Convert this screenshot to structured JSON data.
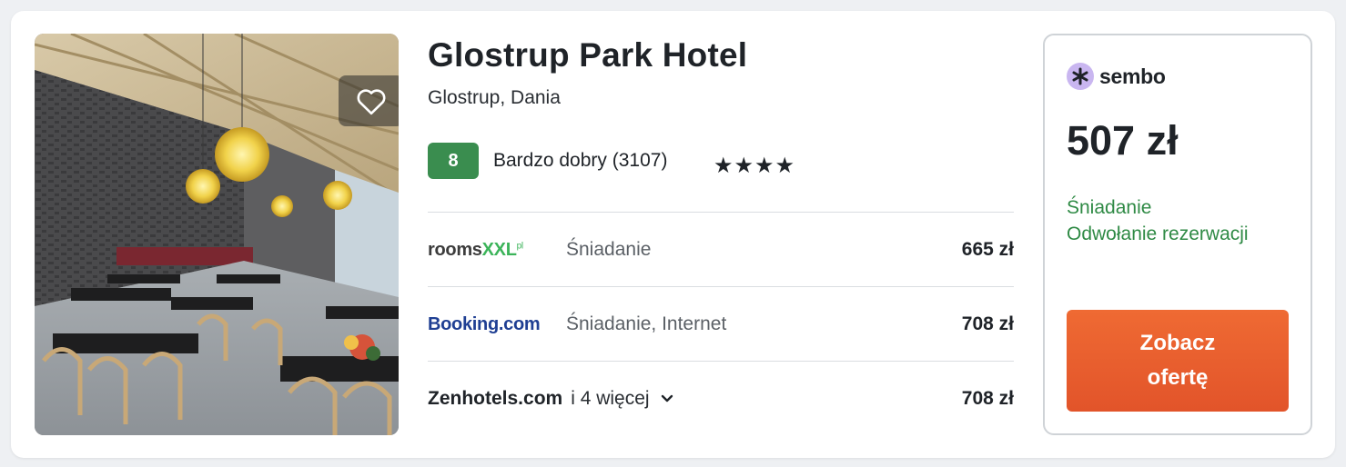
{
  "hotel": {
    "name": "Glostrup Park Hotel",
    "location": "Glostrup, Dania",
    "rating_score": "8",
    "rating_text": "Bardzo dobry (3107)",
    "stars": "★★★★",
    "star_count": 4,
    "favorite_icon": "heart-outline-icon"
  },
  "offers": [
    {
      "provider_main": "rooms",
      "provider_accent": "XXL",
      "provider_sup": "pl",
      "amenities": "Śniadanie",
      "price": "665 zł"
    },
    {
      "provider": "Booking.com",
      "amenities": "Śniadanie, Internet",
      "price": "708 zł"
    },
    {
      "provider": "Zenhotels.com",
      "more": "i 4 więcej",
      "price": "708 zł"
    }
  ],
  "deal": {
    "provider": "sembo",
    "price": "507 zł",
    "perks": [
      "Śniadanie",
      "Odwołanie rezerwacji"
    ],
    "cta_line1": "Zobacz",
    "cta_line2": "ofertę"
  },
  "colors": {
    "rating_badge": "#3a8d4f",
    "perk_text": "#2f8a45",
    "cta": "#e85e2f",
    "booking_brand": "#1f3f93",
    "rooms_brand": "#3cb45a"
  }
}
